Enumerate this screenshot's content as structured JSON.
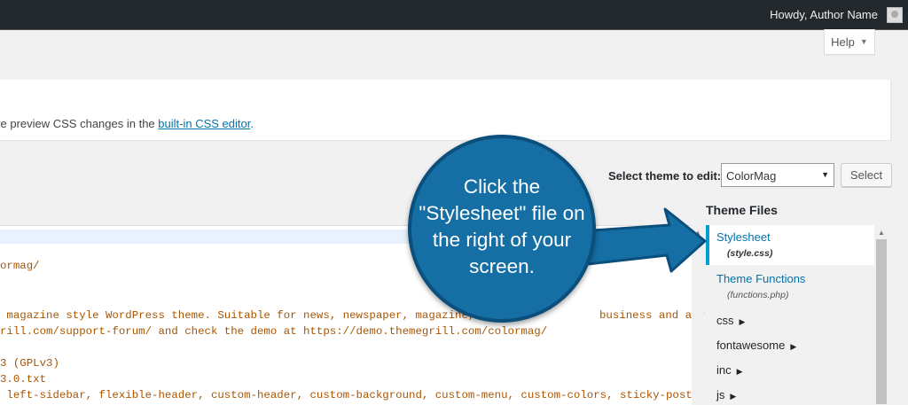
{
  "adminbar": {
    "greeting": "Howdy, Author Name"
  },
  "help": {
    "label": "Help",
    "caret": "▼"
  },
  "notice": {
    "prefix": "ve preview CSS changes in the ",
    "link": "built-in CSS editor",
    "suffix": "."
  },
  "theme_select": {
    "label": "Select theme to edit:",
    "value": "ColorMag",
    "caret": "▼",
    "button": "Select"
  },
  "editor": {
    "lines": [
      "ormag/",
      "",
      "",
      " magazine style WordPress theme. Suitable for news, newspaper, magazine,",
      "rill.com/support-forum/ and check the demo at https://demo.themegrill.com/colormag/",
      "",
      "3 (GPLv3)",
      "3.0.txt",
      " left-sidebar, flexible-header, custom-header, custom-background, custom-menu, custom-colors, sticky-post,"
    ],
    "line_tail_business": "business and any kind"
  },
  "theme_files": {
    "title": "Theme Files",
    "active": {
      "name": "Stylesheet",
      "file": "(style.css)"
    },
    "functions": {
      "name": "Theme Functions",
      "file": "(functions.php)"
    },
    "folders": [
      "css",
      "fontawesome",
      "inc",
      "js"
    ],
    "caret": "▶"
  },
  "callout": {
    "text": "Click the \"Stylesheet\" file on the right of your screen."
  },
  "colors": {
    "accent": "#0073aa",
    "bubble": "#156fa5",
    "active_border": "#00a0d2"
  }
}
